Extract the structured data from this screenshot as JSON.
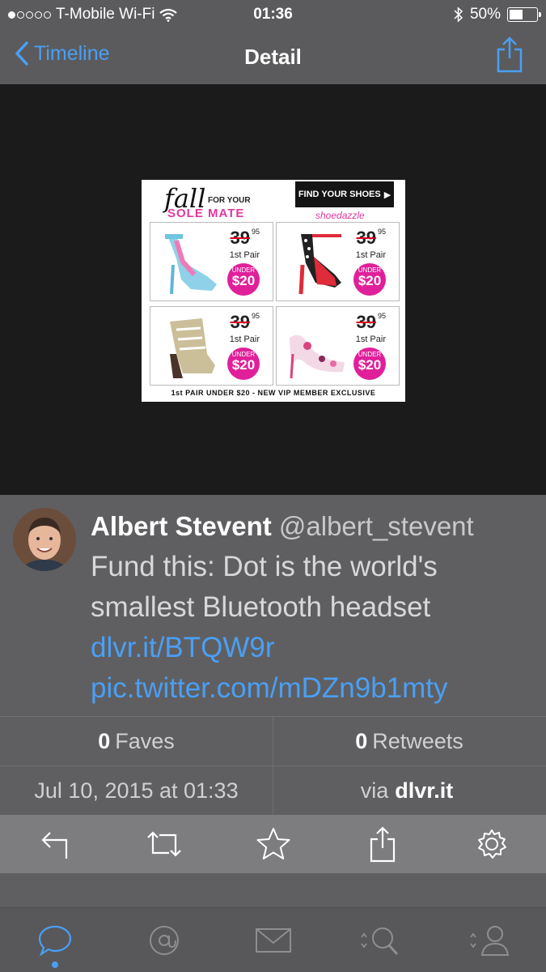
{
  "status_bar": {
    "carrier": "T-Mobile Wi-Fi",
    "time": "01:36",
    "battery_text": "50%",
    "battery_level": 0.5,
    "signal_bars": 1
  },
  "nav": {
    "back_label": "Timeline",
    "title": "Detail"
  },
  "ad": {
    "headline_script": "fall",
    "headline_small": "FOR YOUR",
    "headline_main": "SOLE MATE",
    "cta": "FIND YOUR SHOES",
    "brand": "shoedazzle",
    "items": [
      {
        "old_price": "39",
        "cents": "95",
        "pair": "1st Pair",
        "badge_top": "UNDER",
        "badge_price": "$20"
      },
      {
        "old_price": "39",
        "cents": "95",
        "pair": "1st Pair",
        "badge_top": "UNDER",
        "badge_price": "$20"
      },
      {
        "old_price": "39",
        "cents": "95",
        "pair": "1st Pair",
        "badge_top": "UNDER",
        "badge_price": "$20"
      },
      {
        "old_price": "39",
        "cents": "95",
        "pair": "1st Pair",
        "badge_top": "UNDER",
        "badge_price": "$20"
      }
    ],
    "footer": "1st PAIR UNDER $20 - NEW VIP MEMBER EXCLUSIVE"
  },
  "tweet": {
    "name": "Albert Stevent",
    "handle": "@albert_stevent",
    "text": "Fund this: Dot is the world's smallest Bluetooth headset",
    "link1": "dlvr.it/BTQW9r",
    "link2": "pic.twitter.com/mDZn9b1mty"
  },
  "stats": {
    "faves_count": "0",
    "faves_label": "Faves",
    "retweets_count": "0",
    "retweets_label": "Retweets",
    "date": "Jul 10, 2015 at 01:33",
    "via_label": "via",
    "via_source": "dlvr.it"
  },
  "actions": [
    "reply-icon",
    "retweet-icon",
    "star-icon",
    "share-icon",
    "gear-icon"
  ],
  "tabs": [
    "chat-bubble-icon",
    "mentions-icon",
    "mail-icon",
    "search-icon",
    "profile-icon"
  ],
  "colors": {
    "accent": "#4a9ff5",
    "background": "#5f5f61",
    "media_background": "#1b1b1b",
    "magenta": "#e2389e"
  }
}
